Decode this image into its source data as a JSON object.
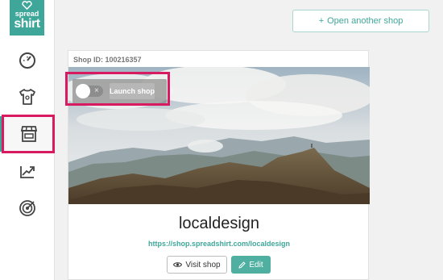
{
  "colors": {
    "brand": "#3fa79a",
    "highlight": "#d81b60"
  },
  "logo": {
    "line1": "spread",
    "line2": "shirt"
  },
  "sidebar": {
    "items": [
      {
        "name": "dashboard",
        "icon": "speedometer-icon"
      },
      {
        "name": "products",
        "icon": "tshirt-icon"
      },
      {
        "name": "shop",
        "icon": "storefront-icon",
        "active": true
      },
      {
        "name": "statistics",
        "icon": "growth-chart-icon"
      },
      {
        "name": "marketing",
        "icon": "target-icon"
      }
    ]
  },
  "header": {
    "open_shop_icon": "+",
    "open_shop_label": "Open another shop"
  },
  "shop": {
    "id_label": "Shop ID: 100216357",
    "toggle_x": "×",
    "launch_label": "Launch shop",
    "name": "localdesign",
    "url": "https://shop.spreadshirt.com/localdesign",
    "visit_label": "Visit shop",
    "edit_label": "Edit",
    "visit_icon": "eye-icon",
    "edit_icon": "pencil-icon",
    "launched": false
  }
}
